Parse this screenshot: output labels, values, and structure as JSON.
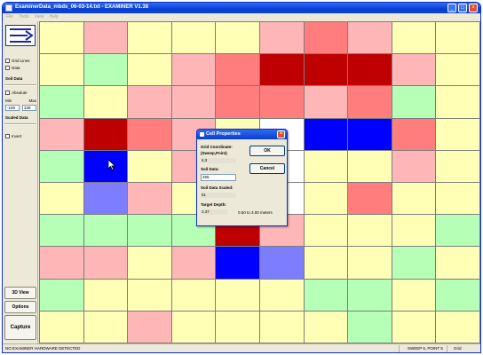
{
  "window": {
    "title": "ExaminerData_mbds_06-03-14.txt - EXAMINER V1.38",
    "min_label": "_",
    "max_label": "□",
    "close_label": "×"
  },
  "menu": [
    "File",
    "Tools",
    "View",
    "Help"
  ],
  "sidebar": {
    "grid_lines_label": "Grid Lines",
    "data_label": "Data",
    "soil_data_heading": "Soil Data",
    "absolute_label": "Absolute",
    "min_label": "Min",
    "max_label": "Max",
    "min_value": "-169",
    "max_value": "338",
    "scaled_data_heading": "Scaled Data",
    "invert_label": "Invert",
    "view3d_label": "3D View",
    "options_label": "Options",
    "capture_label": "Capture"
  },
  "colors": {
    "yellow": "#ffffb6",
    "green": "#b6ffb6",
    "pink": "#ffb6b6",
    "salmon": "#ff7d7d",
    "red": "#bf0000",
    "blue": "#0000ff",
    "lightblue": "#7d7dff",
    "white": "#ffffff"
  },
  "grid": [
    [
      "yellow",
      "pink",
      "yellow",
      "yellow",
      "yellow",
      "pink",
      "salmon",
      "pink",
      "yellow",
      "yellow"
    ],
    [
      "yellow",
      "green",
      "yellow",
      "pink",
      "salmon",
      "red",
      "red",
      "red",
      "pink",
      "yellow"
    ],
    [
      "green",
      "yellow",
      "pink",
      "pink",
      "salmon",
      "salmon",
      "pink",
      "salmon",
      "green",
      "yellow"
    ],
    [
      "pink",
      "red",
      "salmon",
      "pink",
      "yellow",
      "white",
      "blue",
      "blue",
      "salmon",
      "yellow"
    ],
    [
      "green",
      "blue",
      "yellow",
      "pink",
      "yellow",
      "white",
      "yellow",
      "yellow",
      "pink",
      "yellow"
    ],
    [
      "yellow",
      "lightblue",
      "pink",
      "yellow",
      "yellow",
      "white",
      "yellow",
      "salmon",
      "yellow",
      "yellow"
    ],
    [
      "green",
      "green",
      "green",
      "green",
      "red",
      "pink",
      "yellow",
      "yellow",
      "yellow",
      "green"
    ],
    [
      "pink",
      "pink",
      "yellow",
      "pink",
      "blue",
      "lightblue",
      "yellow",
      "yellow",
      "green",
      "yellow"
    ],
    [
      "green",
      "yellow",
      "yellow",
      "yellow",
      "yellow",
      "yellow",
      "green",
      "green",
      "yellow",
      "green"
    ],
    [
      "yellow",
      "yellow",
      "pink",
      "yellow",
      "yellow",
      "yellow",
      "yellow",
      "green",
      "yellow",
      "yellow"
    ]
  ],
  "status": {
    "message": "NO EXAMINER HARDWARE DETECTED",
    "sweep": "SWEEP 6, POINT 5",
    "mode": "Grid"
  },
  "dialog": {
    "title": "Cell Properties",
    "grid_coord_label": "Grid Coordinate:",
    "grid_coord_sub": "(Sweep,Point)",
    "grid_coord_value": "6,3",
    "soil_data_label": "Soil Data:",
    "soil_data_value": "255",
    "soil_scaled_label": "Soil Data Scaled:",
    "soil_scaled_value": "51",
    "target_depth_label": "Target Depth:",
    "target_depth_value": "2.37",
    "depth_range": "0.50 to 3.00 meters",
    "ok_label": "OK",
    "cancel_label": "Cancel",
    "close_label": "×"
  }
}
